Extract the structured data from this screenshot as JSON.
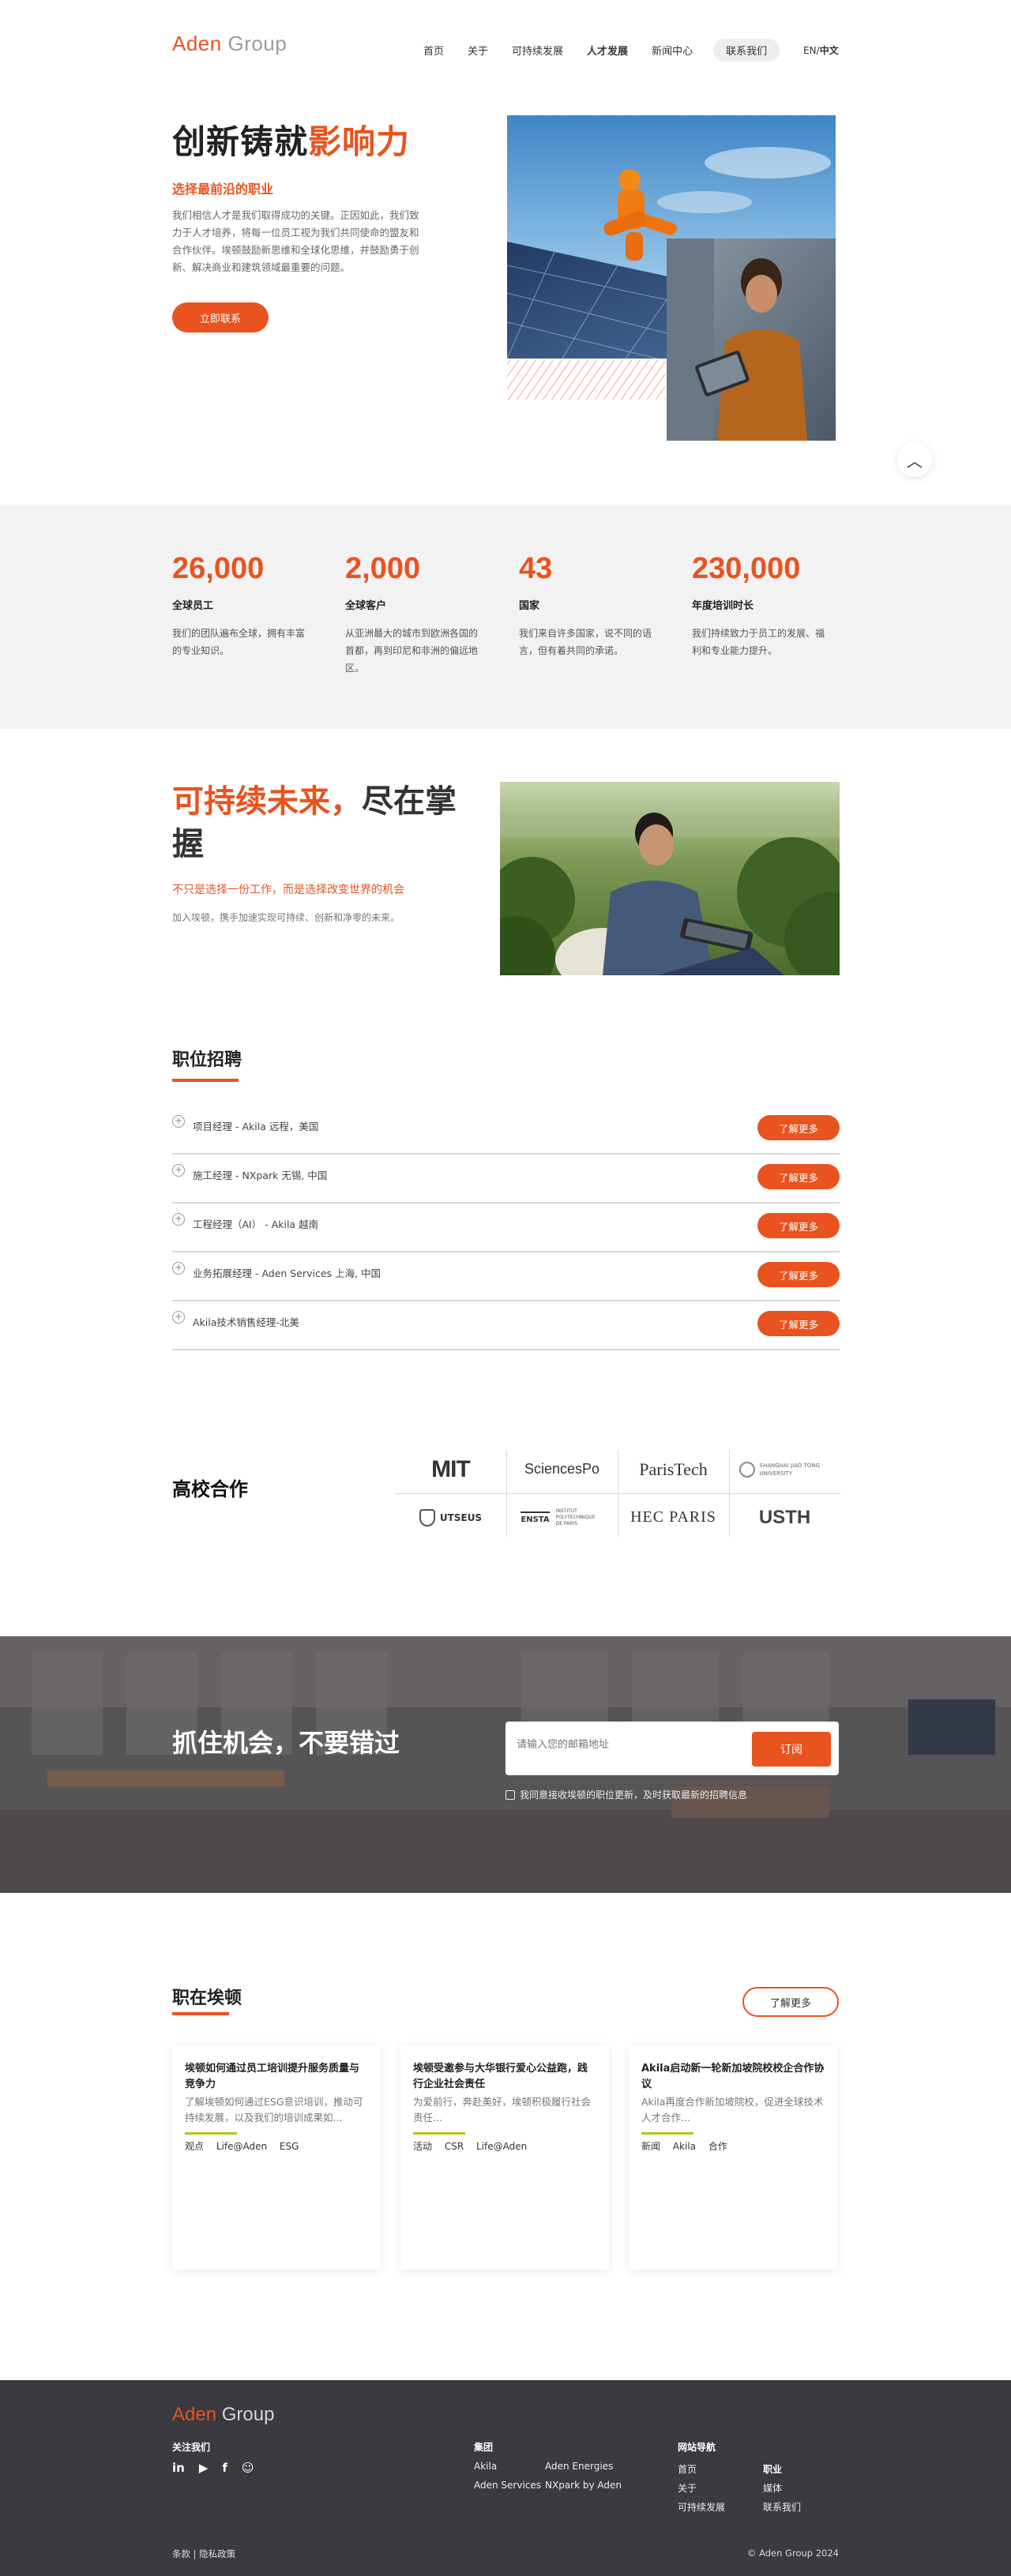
{
  "header": {
    "logo_main": "Aden",
    "logo_sub": "Group",
    "nav": [
      "首页",
      "关于",
      "可持续发展",
      "人才发展",
      "新闻中心"
    ],
    "contact": "联系我们",
    "lang_en": "EN",
    "lang_sep": "/",
    "lang_cn": "中文"
  },
  "hero": {
    "title_a": "创新铸就",
    "title_b": "影响力",
    "subtitle": "选择最前沿的职业",
    "desc": "我们相信人才是我们取得成功的关键。正因如此，我们致力于人才培养，将每一位员工视为我们共同使命的盟友和合作伙伴。埃顿鼓励新思维和全球化思维，并鼓励勇于创新、解决商业和建筑领域最重要的问题。",
    "button": "立即联系"
  },
  "stats": [
    {
      "num": "26,000",
      "label": "全球员工",
      "desc": "我们的团队遍布全球，拥有丰富的专业知识。"
    },
    {
      "num": "2,000",
      "label": "全球客户",
      "desc": "从亚洲最大的城市到欧洲各国的首都，再到印尼和非洲的偏远地区。"
    },
    {
      "num": "43",
      "label": "国家",
      "desc": "我们来自许多国家，说不同的语言，但有着共同的承诺。"
    },
    {
      "num": "230,000",
      "label": "年度培训时长",
      "desc": "我们持续致力于员工的发展、福利和专业能力提升。"
    }
  ],
  "sustain": {
    "title_a": "可持续未来，",
    "title_b": "尽在掌握",
    "subtitle": "不只是选择一份工作，而是选择改变世界的机会",
    "desc": "加入埃顿，携手加速实现可持续、创新和净零的未来。"
  },
  "jobs": {
    "title": "职位招聘",
    "more": "了解更多",
    "items": [
      "项目经理 - Akila 远程，美国",
      "施工经理 - NXpark 无锡, 中国",
      "工程经理（AI） - Akila 越南",
      "业务拓展经理 - Aden Services 上海, 中国",
      "Akila技术销售经理-北美"
    ]
  },
  "universities": {
    "title": "高校合作",
    "logos": [
      "MIT",
      "SciencesPo",
      "ParisTech",
      "SHANGHAI JIAO TONG UNIVERSITY",
      "UTSEUS",
      "ENSTA",
      "INSTITUT POLYTECHNIQUE DE PARIS",
      "HEC PARIS",
      "USTH"
    ]
  },
  "subscribe": {
    "title": "抓住机会，不要错过",
    "placeholder": "请输入您的邮箱地址",
    "button": "订阅",
    "consent": "我同意接收埃顿的职位更新，及时获取最新的招聘信息"
  },
  "news": {
    "title": "职在埃顿",
    "more": "了解更多",
    "cards": [
      {
        "title": "埃顿如何通过员工培训提升服务质量与竞争力",
        "desc": "了解埃顿如何通过ESG意识培训，推动可持续发展，以及我们的培训成果如...",
        "tags": [
          "观点",
          "Life@Aden",
          "ESG"
        ]
      },
      {
        "title": "埃顿受邀参与大华银行爱心公益跑，践行企业社会责任",
        "desc": "为爱前行，奔赴美好，埃顿积极履行社会责任...",
        "tags": [
          "活动",
          "CSR",
          "Life@Aden"
        ]
      },
      {
        "title": "Akila启动新一轮新加坡院校校企合作协议",
        "desc": "Akila再度合作新加坡院校，促进全球技术人才合作...",
        "tags": [
          "新闻",
          "Akila",
          "合作"
        ]
      }
    ]
  },
  "footer": {
    "logo_main": "Aden",
    "logo_sub": "Group",
    "follow": "关注我们",
    "social": [
      "in",
      "▶",
      "f",
      "☺"
    ],
    "group_title": "集团",
    "group_links": [
      "Akila",
      "Aden Energies",
      "Aden Services",
      "NXpark by Aden"
    ],
    "sitemap_title": "网站导航",
    "sitemap_links": [
      "首页",
      "关于",
      "可持续发展"
    ],
    "career_title": "职业",
    "career_links": [
      "媒体",
      "联系我们"
    ],
    "legal": "条款 | 隐私政策",
    "copyright": "© Aden Group 2024"
  },
  "colors": {
    "accent": "#e8531f",
    "footer_bg": "#3a3a40",
    "stats_bg": "#f1f2f1",
    "tag_bar": "#b6c21a"
  }
}
